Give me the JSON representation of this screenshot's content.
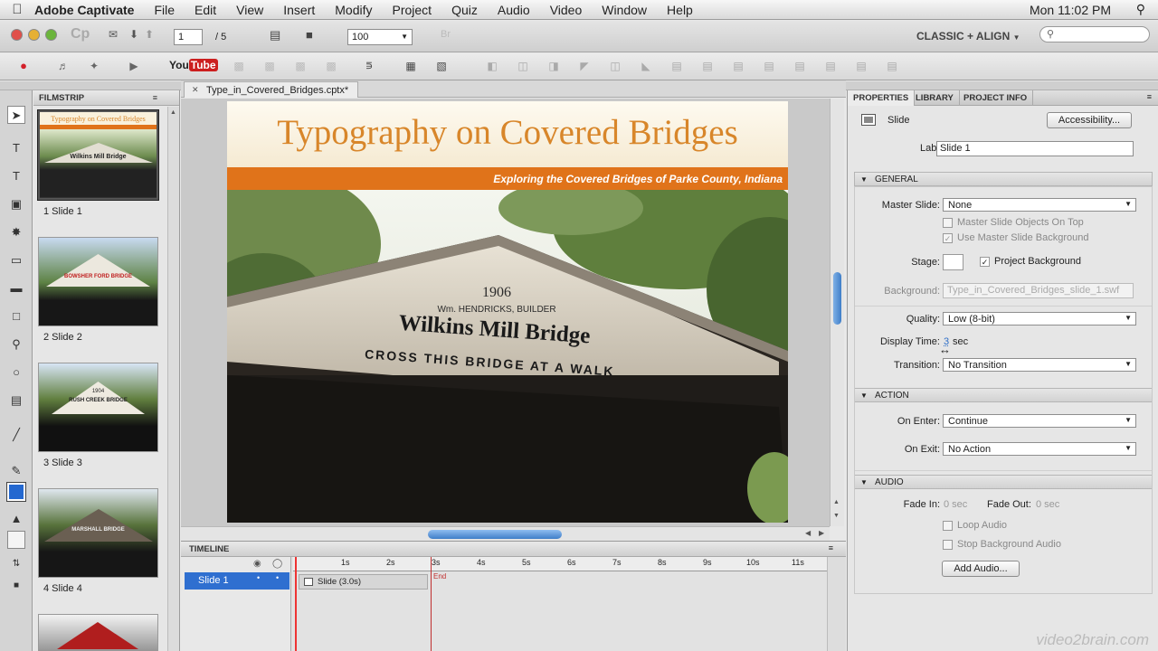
{
  "menubar": {
    "app_name": "Adobe Captivate",
    "items": [
      "File",
      "Edit",
      "View",
      "Insert",
      "Modify",
      "Project",
      "Quiz",
      "Audio",
      "Video",
      "Window",
      "Help"
    ],
    "clock": "Mon 11:02 PM"
  },
  "toolbar": {
    "slide_number": "1",
    "slide_total": "/ 5",
    "zoom": "100",
    "workspace": "CLASSIC + ALIGN",
    "youtube_label": "YouTube"
  },
  "filmstrip": {
    "title": "FILMSTRIP",
    "slides": [
      {
        "label": "1 Slide 1",
        "caption": "Typography on Covered Bridges",
        "bridge": "Wilkins Mill Bridge"
      },
      {
        "label": "2 Slide 2",
        "bridge": "BOWSHER FORD BRIDGE"
      },
      {
        "label": "3 Slide 3",
        "bridge": "RUSH CREEK BRIDGE",
        "year": "1904"
      },
      {
        "label": "4 Slide 4",
        "bridge": "MARSHALL BRIDGE"
      }
    ]
  },
  "document": {
    "tab_title": "Type_in_Covered_Bridges.cptx*"
  },
  "slide": {
    "title": "Typography on Covered Bridges",
    "subtitle": "Exploring the Covered Bridges of Parke County, Indiana",
    "sign_year": "1906",
    "sign_builder": "Wm. HENDRICKS, BUILDER",
    "sign_name": "Wilkins Mill Bridge",
    "sign_warning": "CROSS THIS BRIDGE AT A WALK"
  },
  "timeline": {
    "title": "TIMELINE",
    "row_label": "Slide 1",
    "bar_label": "Slide (3.0s)",
    "end_label": "End",
    "ticks": [
      "1s",
      "2s",
      "3s",
      "4s",
      "5s",
      "6s",
      "7s",
      "8s",
      "9s",
      "10s",
      "11s"
    ]
  },
  "properties": {
    "tabs": [
      "PROPERTIES",
      "LIBRARY",
      "PROJECT INFO"
    ],
    "object_type": "Slide",
    "accessibility_button": "Accessibility...",
    "label_caption": "Label:",
    "label_value": "Slide 1",
    "general": {
      "title": "GENERAL",
      "master_slide_label": "Master Slide:",
      "master_slide_value": "None",
      "master_objects_on_top": "Master Slide Objects On Top",
      "use_master_background": "Use Master Slide Background",
      "stage_label": "Stage:",
      "project_background": "Project Background",
      "background_label": "Background:",
      "background_value": "Type_in_Covered_Bridges_slide_1.swf",
      "quality_label": "Quality:",
      "quality_value": "Low (8-bit)",
      "display_time_label": "Display Time:",
      "display_time_value": "3",
      "display_time_unit": "sec",
      "transition_label": "Transition:",
      "transition_value": "No Transition"
    },
    "action": {
      "title": "ACTION",
      "on_enter_label": "On Enter:",
      "on_enter_value": "Continue",
      "on_exit_label": "On Exit:",
      "on_exit_value": "No Action"
    },
    "audio": {
      "title": "AUDIO",
      "fade_in_label": "Fade In:",
      "fade_in_value": "0 sec",
      "fade_out_label": "Fade Out:",
      "fade_out_value": "0 sec",
      "loop_audio": "Loop Audio",
      "stop_background_audio": "Stop Background Audio",
      "add_audio_button": "Add Audio..."
    }
  },
  "watermark": "video2brain.com"
}
